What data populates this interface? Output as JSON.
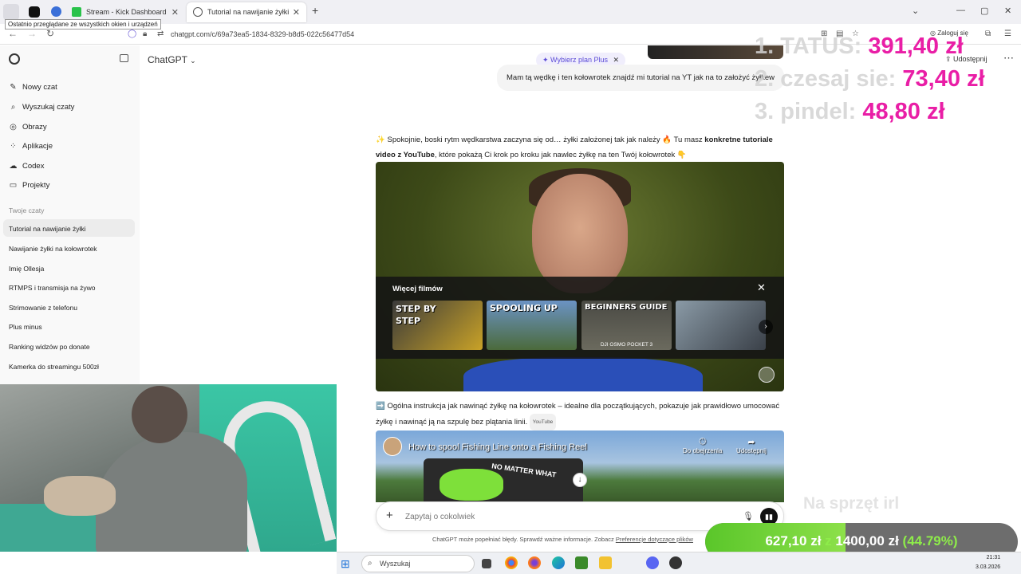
{
  "browser": {
    "tooltip": "Ostatnio przeglądane ze wszystkich okien i urządzeń",
    "tabs": [
      {
        "label": "Stream - Kick Dashboard",
        "favicon_color": "#29c24a"
      },
      {
        "label": "Tutorial na nawijanie żyłki",
        "favicon_color": "#555555"
      }
    ],
    "new_tab": "+",
    "url": "chatgpt.com/c/69a73ea5-1834-8329-b8d5-022c56477d54",
    "login_label": "Zaloguj się"
  },
  "sidebar": {
    "items": [
      {
        "label": "Nowy czat",
        "icon": "edit-icon"
      },
      {
        "label": "Wyszukaj czaty",
        "icon": "search-icon"
      },
      {
        "label": "Obrazy",
        "icon": "image-icon"
      },
      {
        "label": "Aplikacje",
        "icon": "apps-icon"
      },
      {
        "label": "Codex",
        "icon": "codex-icon"
      },
      {
        "label": "Projekty",
        "icon": "folder-icon"
      }
    ],
    "section_title": "Twoje czaty",
    "chats": [
      "Tutorial na nawijanie żyłki",
      "Nawijanie żyłki na kołowrotek",
      "Imię Ollesja",
      "RTMPS i transmisja na żywo",
      "Strimowanie z telefonu",
      "Plus minus",
      "Ranking widzów po donate",
      "Kamerka do streamingu 500zł"
    ]
  },
  "main": {
    "model": "ChatGPT",
    "plus_button": "Wybierz plan Plus",
    "share": "Udostępnij",
    "user_message": "Mam tą wędkę i ten kołowrotek znajdź mi tutorial na YT jak na to założyć żyłkew",
    "assistant_intro_1": "Spokojnie, boski rytm wędkarstwa zaczyna się od… żyłki założonej tak jak należy 🔥 Tu masz ",
    "assistant_intro_bold": "konkretne tutoriale video z YouTube",
    "assistant_intro_2": ", które pokażą Ci krok po kroku jak nawlec żyłkę na ten Twój kołowrotek 👇",
    "more_videos": "Więcej filmów",
    "thumbnails": [
      {
        "label": "STEP BY STEP",
        "sub": ""
      },
      {
        "label": "SPOOLING UP",
        "sub": ""
      },
      {
        "label": "BEGINNERS GUIDE",
        "sub": "DJI OSMO POCKET 3"
      },
      {
        "label": "",
        "sub": ""
      }
    ],
    "para2": "➡️ Ogólna instrukcja jak nawinąć żyłkę na kołowrotek – idealne dla początkujących, pokazuje jak prawidłowo umocować żyłkę i nawinąć ją na szpulę bez plątania linii.",
    "para2_source": "YouTube",
    "video2_title": "How to spool Fishing Line onto a Fishing Reel",
    "video2_watch": "Do obejrzenia",
    "video2_share": "Udostępnij",
    "video2_spool_text": "NO MATTER WHAT",
    "composer_placeholder": "Zapytaj o cokolwiek",
    "disclaimer": "ChatGPT może popełniać błędy. Sprawdź ważne informacje. Zobacz ",
    "disclaimer_link": "Preferencje dotyczące plików"
  },
  "overlay": {
    "ranking": [
      {
        "name": "1. TATUS:",
        "amount": "391,40 zł"
      },
      {
        "name": "2. czesaj sie:",
        "amount": "73,40 zł"
      },
      {
        "name": "3. pindel:",
        "amount": "48,80 zł"
      }
    ],
    "goal_title": "Na sprzęt irl",
    "goal_current": "627,10 zł",
    "goal_sep": "z",
    "goal_target": "1400,00 zł",
    "goal_percent": "(44.79%)",
    "goal_fraction": 0.4479
  },
  "taskbar": {
    "search_placeholder": "Wyszukaj",
    "time": "21:31",
    "date": "3.03.2026"
  },
  "colors": {
    "accent_pink": "#e91ea6",
    "goal_green": "#5ac62a",
    "plus_purple": "#5b4bd6"
  }
}
